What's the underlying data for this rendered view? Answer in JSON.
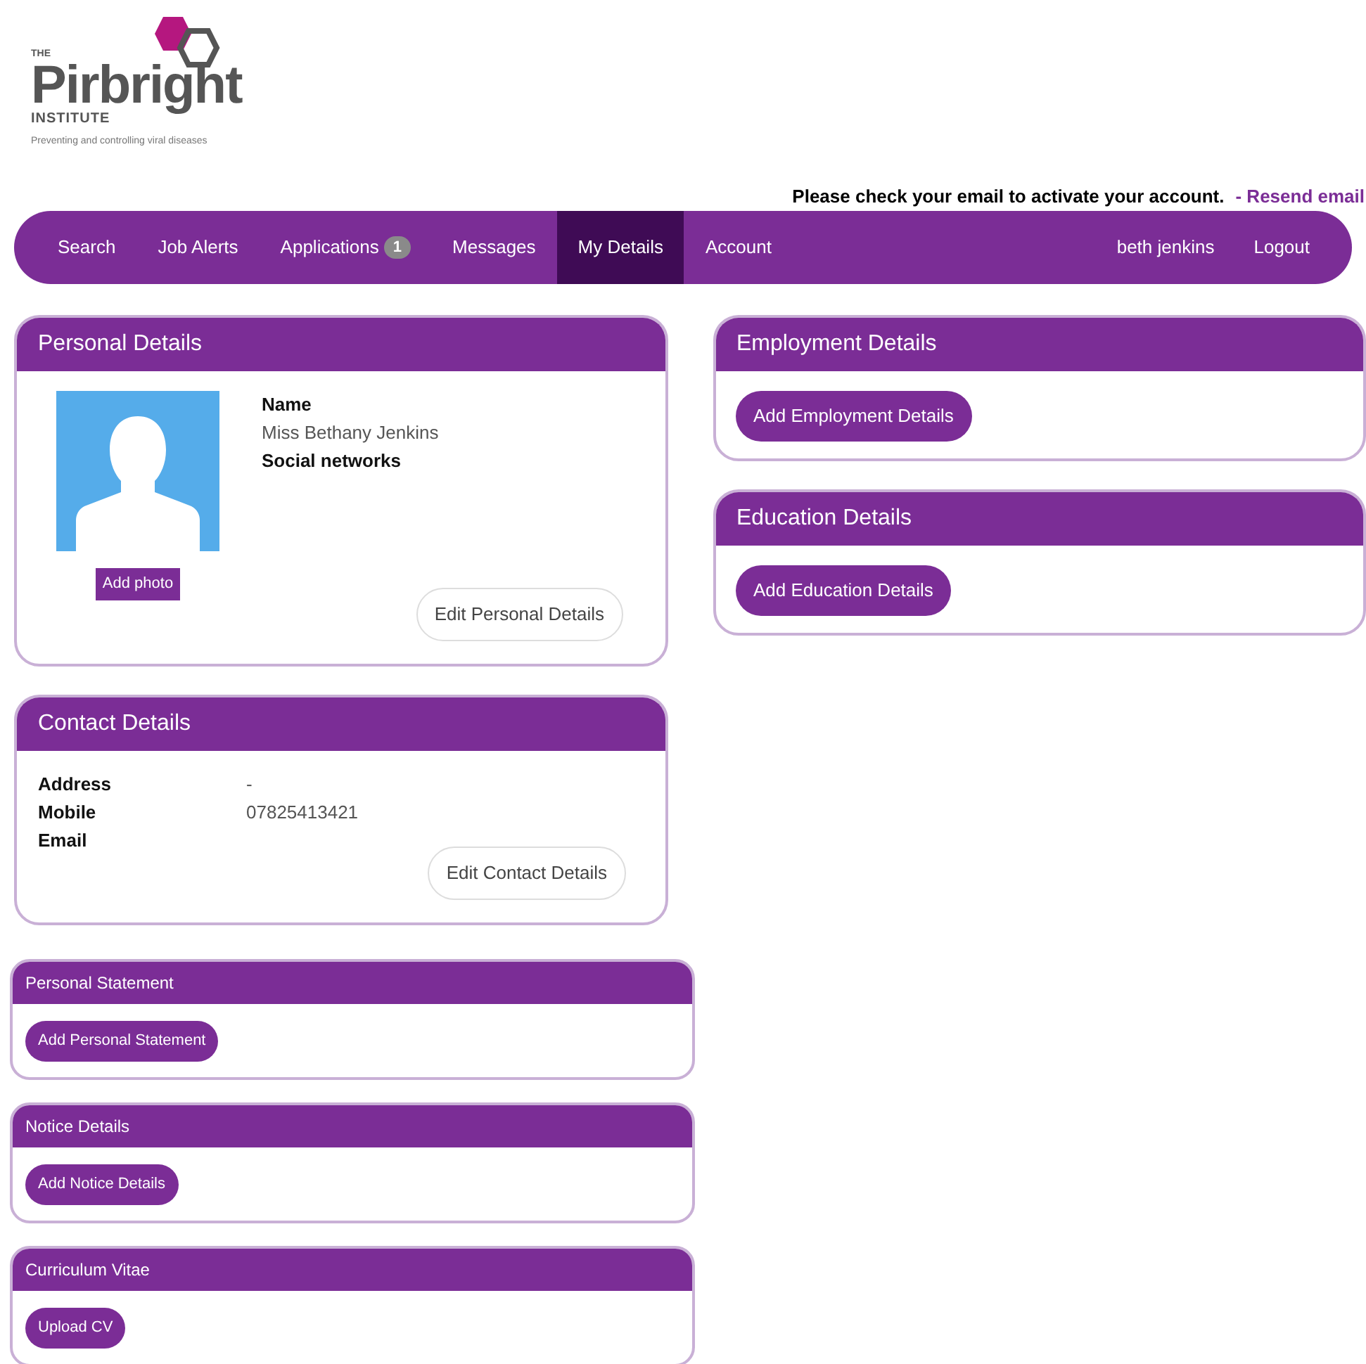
{
  "logo": {
    "prefix": "THE",
    "name": "Pirbright",
    "sub": "INSTITUTE",
    "tagline": "Preventing and controlling viral diseases"
  },
  "notice": {
    "text": "Please check your email to activate your account.",
    "link": "- Resend email"
  },
  "nav": {
    "items": [
      {
        "label": "Search",
        "selected": false
      },
      {
        "label": "Job Alerts",
        "selected": false
      },
      {
        "label": "Applications",
        "badge": "1",
        "selected": false
      },
      {
        "label": "Messages",
        "selected": false
      },
      {
        "label": "My Details",
        "selected": true
      },
      {
        "label": "Account",
        "selected": false
      }
    ],
    "right": [
      {
        "label": "beth jenkins"
      },
      {
        "label": "Logout"
      }
    ]
  },
  "personal": {
    "title": "Personal Details",
    "photo_button": "Add photo",
    "fields": [
      {
        "label": "Name",
        "value": "Miss Bethany Jenkins"
      },
      {
        "label": "Social networks"
      }
    ],
    "button": "Edit Personal Details"
  },
  "contact": {
    "title": "Contact Details",
    "fields": [
      {
        "label": "Address",
        "value": "-"
      },
      {
        "label": "Mobile",
        "value": "07825413421"
      },
      {
        "label": "Email"
      }
    ],
    "button": "Edit Contact Details"
  },
  "right_cards": [
    {
      "title": "Employment Details",
      "button": "Add Employment Details"
    },
    {
      "title": "Education Details",
      "button": "Add Education Details"
    }
  ],
  "lower_cards": [
    {
      "title": "Personal Statement",
      "button": "Add Personal Statement"
    },
    {
      "title": "Notice Details",
      "button": "Add Notice Details"
    },
    {
      "title": "Curriculum Vitae",
      "button": "Upload CV"
    }
  ]
}
